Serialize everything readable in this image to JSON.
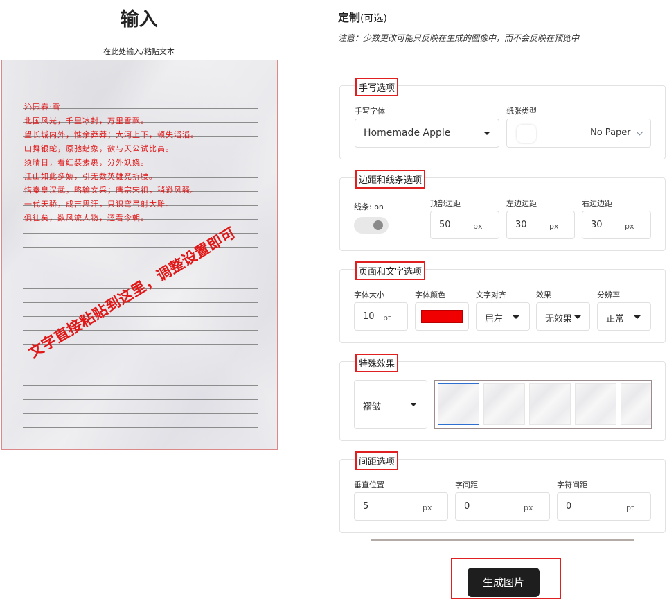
{
  "input": {
    "title": "输入",
    "hint": "在此处输入/粘贴文本",
    "poem_lines": [
      "沁园春·雪",
      "北国风光，千里冰封，万里雪飘。",
      "望长城内外，惟余莽莽；大河上下，顿失滔滔。",
      "山舞银蛇，原驰蜡象，欲与天公试比高。",
      "须晴日，看红装素裹，分外妖娆。",
      "江山如此多娇，引无数英雄竞折腰。",
      "惜秦皇汉武，略输文采；唐宗宋祖，稍逊风骚。",
      "一代天骄，成吉思汗，只识弯弓射大雕。",
      "俱往矣，数风流人物，还看今朝。"
    ],
    "watermark": "文字直接粘贴到这里，调整设置即可"
  },
  "customize": {
    "title": "定制",
    "title_optional": "(可选)",
    "note": "注意：少数更改可能只反映在生成的图像中，而不会反映在预览中"
  },
  "handwriting": {
    "legend": "手写选项",
    "font_label": "手写字体",
    "font_value": "Homemade Apple",
    "paper_label": "纸张类型",
    "paper_value": "No Paper"
  },
  "margins": {
    "legend": "边距和线条选项",
    "lines_label": "线条: on",
    "top_label": "顶部边距",
    "top_value": "50",
    "left_label": "左边边距",
    "left_value": "30",
    "right_label": "右边边距",
    "right_value": "30",
    "unit": "px"
  },
  "page_text": {
    "legend": "页面和文字选项",
    "font_size_label": "字体大小",
    "font_size_value": "10",
    "font_size_unit": "pt",
    "font_color_label": "字体颜色",
    "font_color": "#f00000",
    "align_label": "文字对齐",
    "align_value": "居左",
    "effect_label": "效果",
    "effect_value": "无效果",
    "resolution_label": "分辨率",
    "resolution_value": "正常"
  },
  "special": {
    "legend": "特殊效果",
    "effect_value": "褶皱"
  },
  "spacing": {
    "legend": "间距选项",
    "vertical_label": "垂直位置",
    "vertical_value": "5",
    "vertical_unit": "px",
    "letter_label": "字间距",
    "letter_value": "0",
    "letter_unit": "px",
    "word_label": "字符间距",
    "word_value": "0",
    "word_unit": "pt"
  },
  "generate_label": "生成图片",
  "colors": {
    "accent_red": "#e02020",
    "ink_red": "#e01818",
    "button_dark": "#1e1e1e"
  }
}
